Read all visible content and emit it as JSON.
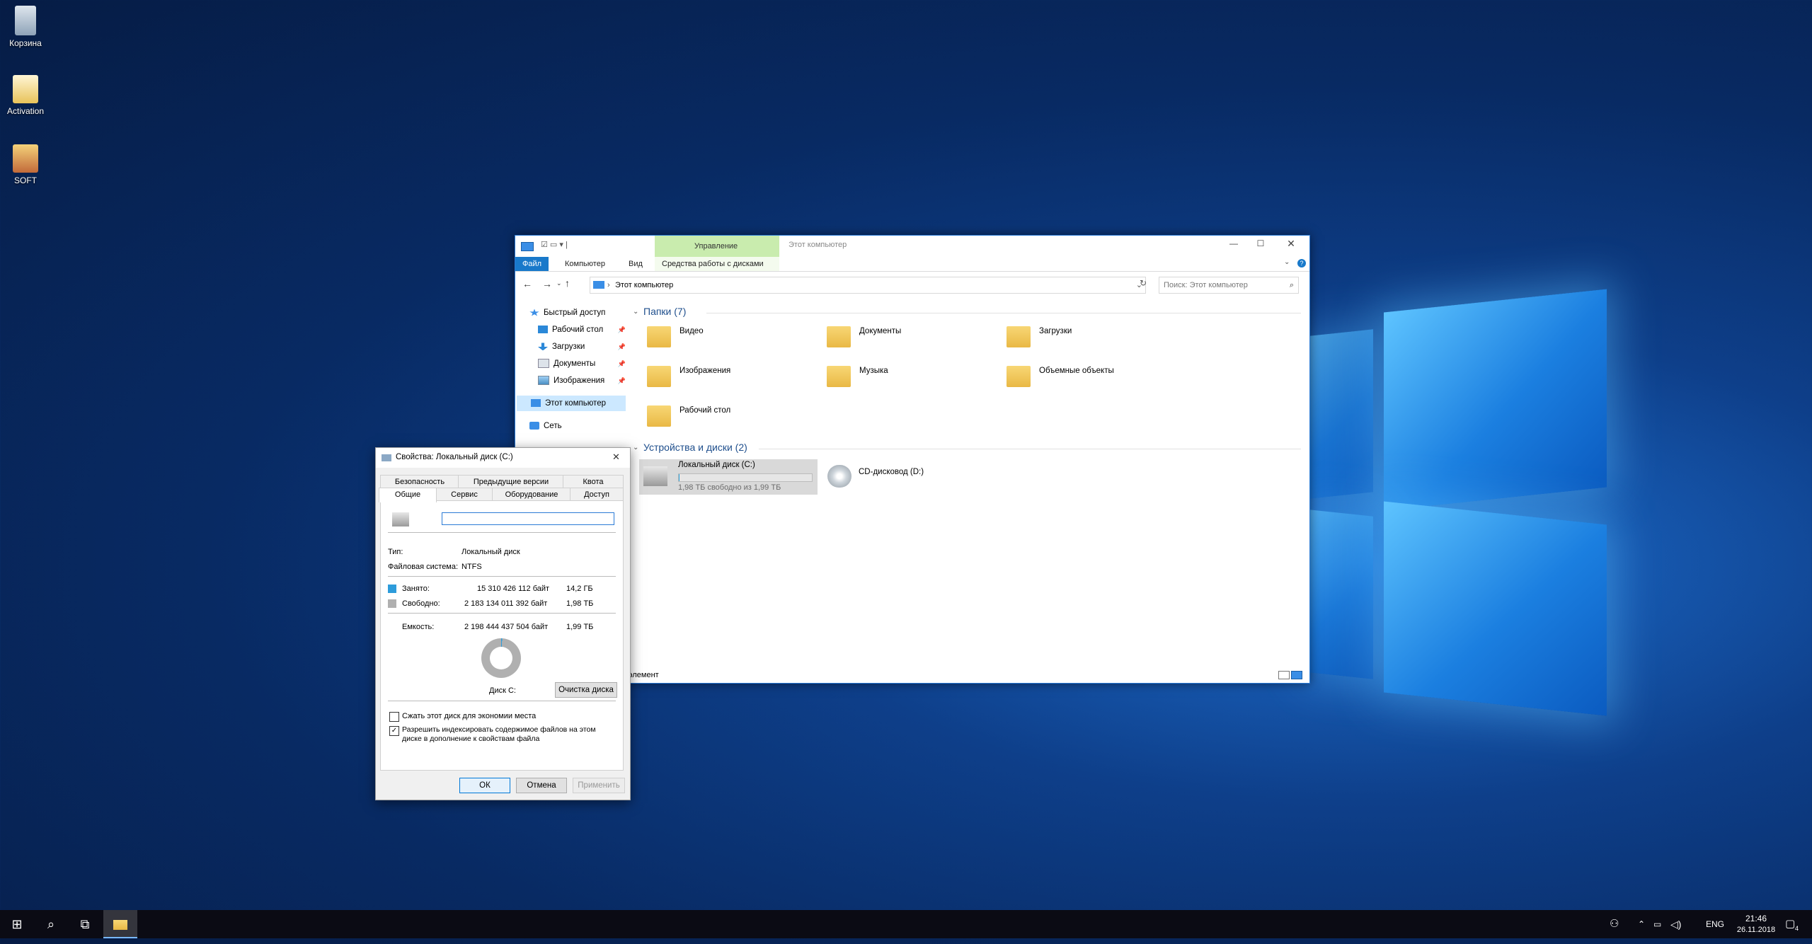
{
  "desktop": {
    "icons": [
      {
        "label": "Корзина",
        "icon": "recycle-bin-icon"
      },
      {
        "label": "Activation",
        "icon": "activation-app-icon"
      },
      {
        "label": "SOFT",
        "icon": "archive-icon"
      }
    ]
  },
  "explorer": {
    "title": "Этот компьютер",
    "context_tab": "Управление",
    "ribbon_tabs": [
      "Файл",
      "Компьютер",
      "Вид",
      "Средства работы с дисками"
    ],
    "address": "Этот компьютер",
    "search_placeholder": "Поиск: Этот компьютер",
    "nav": {
      "quick_access": "Быстрый доступ",
      "quick_items": [
        "Рабочий стол",
        "Загрузки",
        "Документы",
        "Изображения"
      ],
      "this_pc": "Этот компьютер",
      "network": "Сеть"
    },
    "folders_header": "Папки (7)",
    "folders": [
      "Видео",
      "Документы",
      "Загрузки",
      "Изображения",
      "Музыка",
      "Объемные объекты",
      "Рабочий стол"
    ],
    "devices_header": "Устройства и диски (2)",
    "drive_c": {
      "name": "Локальный диск (C:)",
      "free": "1,98 ТБ свободно из 1,99 ТБ",
      "used_fraction": 0.007
    },
    "drive_d": {
      "name": "CD-дисковод (D:)"
    },
    "status": "элемент"
  },
  "dialog": {
    "title": "Свойства: Локальный диск (C:)",
    "tabs_row1": [
      "Безопасность",
      "Предыдущие версии",
      "Квота"
    ],
    "tabs_row2": [
      "Общие",
      "Сервис",
      "Оборудование",
      "Доступ"
    ],
    "name_value": "",
    "type_label": "Тип:",
    "type_value": "Локальный диск",
    "fs_label": "Файловая система:",
    "fs_value": "NTFS",
    "used_label": "Занято:",
    "used_bytes": "15 310 426 112 байт",
    "used_size": "14,2 ГБ",
    "free_label": "Свободно:",
    "free_bytes": "2 183 134 011 392 байт",
    "free_size": "1,98 ТБ",
    "cap_label": "Емкость:",
    "cap_bytes": "2 198 444 437 504 байт",
    "cap_size": "1,99 ТБ",
    "disk_label": "Диск C:",
    "cleanup": "Очистка диска",
    "compress": "Сжать этот диск для экономии места",
    "index_line1": "Разрешить индексировать содержимое файлов на этом",
    "index_line2": "диске в дополнение к свойствам файла",
    "ok": "ОК",
    "cancel": "Отмена",
    "apply": "Применить",
    "colors": {
      "used": "#2d9cdb",
      "free": "#b0b0b0"
    }
  },
  "taskbar": {
    "lang": "ENG",
    "time": "21:46",
    "date": "26.11.2018",
    "notif_count": "4"
  }
}
